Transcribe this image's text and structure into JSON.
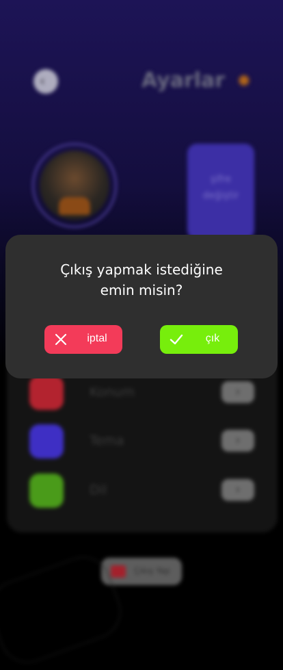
{
  "screen": {
    "title": "Ayarlar"
  },
  "profile": {
    "change_photo_label": "şifre değiştir"
  },
  "settings_rows": [
    {
      "label": "Konum",
      "icon": "location-pin-icon",
      "color": "#b3232f"
    },
    {
      "label": "Tema",
      "icon": "palette-icon",
      "color": "#3e2fc4"
    },
    {
      "label": "Dil",
      "icon": "translate-icon",
      "color": "#4a9b1a"
    }
  ],
  "logout": {
    "label": "Çıkış Yap"
  },
  "dialog": {
    "message": "Çıkış yapmak istediğine\nemin misin?",
    "cancel_label": "iptal",
    "confirm_label": "çık",
    "cancel_color": "#f33b59",
    "confirm_color": "#77ee0c"
  },
  "colors": {
    "accent_purple": "#3c2fa5",
    "dialog_bg": "#2f2f2f"
  }
}
